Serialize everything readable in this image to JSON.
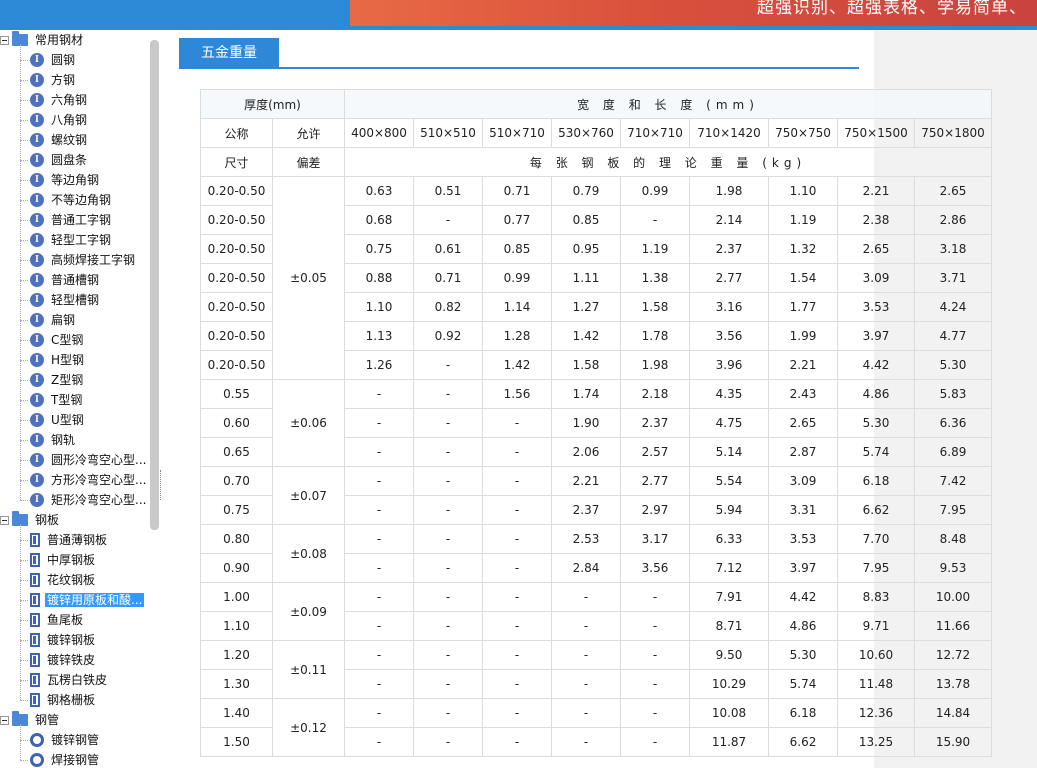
{
  "banner": {
    "slogan": "超强识别、超强表格、学易简单、"
  },
  "tree": [
    {
      "type": "folder",
      "label": "常用钢材",
      "level": 0
    },
    {
      "type": "i",
      "label": "圆钢",
      "level": 1
    },
    {
      "type": "i",
      "label": "方钢",
      "level": 1
    },
    {
      "type": "i",
      "label": "六角钢",
      "level": 1
    },
    {
      "type": "i",
      "label": "八角钢",
      "level": 1
    },
    {
      "type": "i",
      "label": "螺纹钢",
      "level": 1
    },
    {
      "type": "i",
      "label": "圆盘条",
      "level": 1
    },
    {
      "type": "i",
      "label": "等边角钢",
      "level": 1
    },
    {
      "type": "i",
      "label": "不等边角钢",
      "level": 1
    },
    {
      "type": "i",
      "label": "普通工字钢",
      "level": 1
    },
    {
      "type": "i",
      "label": "轻型工字钢",
      "level": 1
    },
    {
      "type": "i",
      "label": "高频焊接工字钢",
      "level": 1
    },
    {
      "type": "i",
      "label": "普通槽钢",
      "level": 1
    },
    {
      "type": "i",
      "label": "轻型槽钢",
      "level": 1
    },
    {
      "type": "i",
      "label": "扁钢",
      "level": 1
    },
    {
      "type": "i",
      "label": "C型钢",
      "level": 1
    },
    {
      "type": "i",
      "label": "H型钢",
      "level": 1
    },
    {
      "type": "i",
      "label": "Z型钢",
      "level": 1
    },
    {
      "type": "i",
      "label": "T型钢",
      "level": 1
    },
    {
      "type": "i",
      "label": "U型钢",
      "level": 1
    },
    {
      "type": "i",
      "label": "钢轨",
      "level": 1
    },
    {
      "type": "i",
      "label": "圆形冷弯空心型...",
      "level": 1
    },
    {
      "type": "i",
      "label": "方形冷弯空心型...",
      "level": 1
    },
    {
      "type": "i",
      "label": "矩形冷弯空心型...",
      "level": 1
    },
    {
      "type": "folder",
      "label": "钢板",
      "level": 0
    },
    {
      "type": "plate",
      "label": "普通薄钢板",
      "level": 1
    },
    {
      "type": "plate",
      "label": "中厚钢板",
      "level": 1
    },
    {
      "type": "plate",
      "label": "花纹钢板",
      "level": 1
    },
    {
      "type": "plate",
      "label": "镀锌用原板和酸...",
      "level": 1,
      "selected": true
    },
    {
      "type": "plate",
      "label": "鱼尾板",
      "level": 1
    },
    {
      "type": "plate",
      "label": "镀锌钢板",
      "level": 1
    },
    {
      "type": "plate",
      "label": "镀锌铁皮",
      "level": 1
    },
    {
      "type": "plate",
      "label": "瓦楞白铁皮",
      "level": 1
    },
    {
      "type": "plate",
      "label": "钢格栅板",
      "level": 1
    },
    {
      "type": "folder",
      "label": "钢管",
      "level": 0
    },
    {
      "type": "pipe",
      "label": "镀锌钢管",
      "level": 1
    },
    {
      "type": "pipe",
      "label": "焊接钢管",
      "level": 1
    }
  ],
  "tab": {
    "label": "五金重量"
  },
  "table": {
    "thickness_header": "厚度(mm)",
    "width_length_header": "宽 度 和 长 度 (mm)",
    "nominal_line1": "公称",
    "nominal_line2": "尺寸",
    "tolerance_line1": "允许",
    "tolerance_line2": "偏差",
    "size_columns": [
      "400×800",
      "510×510",
      "510×710",
      "530×760",
      "710×710",
      "710×1420",
      "750×750",
      "750×1500",
      "750×1800"
    ],
    "weight_header": "每 张 钢 板 的 理 论 重 量 (kg)",
    "tolerance_groups": [
      {
        "value": "±0.05",
        "span": 7
      },
      {
        "value": "±0.06",
        "span": 3
      },
      {
        "value": "±0.07",
        "span": 2
      },
      {
        "value": "±0.08",
        "span": 2
      },
      {
        "value": "±0.09",
        "span": 2
      },
      {
        "value": "±0.11",
        "span": 2
      },
      {
        "value": "±0.12",
        "span": 2
      }
    ],
    "rows": [
      {
        "t": "0.20-0.50",
        "w": [
          "0.63",
          "0.51",
          "0.71",
          "0.79",
          "0.99",
          "1.98",
          "1.10",
          "2.21",
          "2.65"
        ]
      },
      {
        "t": "0.20-0.50",
        "w": [
          "0.68",
          "-",
          "0.77",
          "0.85",
          "-",
          "2.14",
          "1.19",
          "2.38",
          "2.86"
        ]
      },
      {
        "t": "0.20-0.50",
        "w": [
          "0.75",
          "0.61",
          "0.85",
          "0.95",
          "1.19",
          "2.37",
          "1.32",
          "2.65",
          "3.18"
        ]
      },
      {
        "t": "0.20-0.50",
        "w": [
          "0.88",
          "0.71",
          "0.99",
          "1.11",
          "1.38",
          "2.77",
          "1.54",
          "3.09",
          "3.71"
        ]
      },
      {
        "t": "0.20-0.50",
        "w": [
          "1.10",
          "0.82",
          "1.14",
          "1.27",
          "1.58",
          "3.16",
          "1.77",
          "3.53",
          "4.24"
        ]
      },
      {
        "t": "0.20-0.50",
        "w": [
          "1.13",
          "0.92",
          "1.28",
          "1.42",
          "1.78",
          "3.56",
          "1.99",
          "3.97",
          "4.77"
        ]
      },
      {
        "t": "0.20-0.50",
        "w": [
          "1.26",
          "-",
          "1.42",
          "1.58",
          "1.98",
          "3.96",
          "2.21",
          "4.42",
          "5.30"
        ]
      },
      {
        "t": "0.55",
        "w": [
          "-",
          "-",
          "1.56",
          "1.74",
          "2.18",
          "4.35",
          "2.43",
          "4.86",
          "5.83"
        ]
      },
      {
        "t": "0.60",
        "w": [
          "-",
          "-",
          "-",
          "1.90",
          "2.37",
          "4.75",
          "2.65",
          "5.30",
          "6.36"
        ]
      },
      {
        "t": "0.65",
        "w": [
          "-",
          "-",
          "-",
          "2.06",
          "2.57",
          "5.14",
          "2.87",
          "5.74",
          "6.89"
        ]
      },
      {
        "t": "0.70",
        "w": [
          "-",
          "-",
          "-",
          "2.21",
          "2.77",
          "5.54",
          "3.09",
          "6.18",
          "7.42"
        ]
      },
      {
        "t": "0.75",
        "w": [
          "-",
          "-",
          "-",
          "2.37",
          "2.97",
          "5.94",
          "3.31",
          "6.62",
          "7.95"
        ]
      },
      {
        "t": "0.80",
        "w": [
          "-",
          "-",
          "-",
          "2.53",
          "3.17",
          "6.33",
          "3.53",
          "7.70",
          "8.48"
        ]
      },
      {
        "t": "0.90",
        "w": [
          "-",
          "-",
          "-",
          "2.84",
          "3.56",
          "7.12",
          "3.97",
          "7.95",
          "9.53"
        ]
      },
      {
        "t": "1.00",
        "w": [
          "-",
          "-",
          "-",
          "-",
          "-",
          "7.91",
          "4.42",
          "8.83",
          "10.00"
        ]
      },
      {
        "t": "1.10",
        "w": [
          "-",
          "-",
          "-",
          "-",
          "-",
          "8.71",
          "4.86",
          "9.71",
          "11.66"
        ]
      },
      {
        "t": "1.20",
        "w": [
          "-",
          "-",
          "-",
          "-",
          "-",
          "9.50",
          "5.30",
          "10.60",
          "12.72"
        ]
      },
      {
        "t": "1.30",
        "w": [
          "-",
          "-",
          "-",
          "-",
          "-",
          "10.29",
          "5.74",
          "11.48",
          "13.78"
        ]
      },
      {
        "t": "1.40",
        "w": [
          "-",
          "-",
          "-",
          "-",
          "-",
          "10.08",
          "6.18",
          "12.36",
          "14.84"
        ]
      },
      {
        "t": "1.50",
        "w": [
          "-",
          "-",
          "-",
          "-",
          "-",
          "11.87",
          "6.62",
          "13.25",
          "15.90"
        ]
      }
    ]
  }
}
